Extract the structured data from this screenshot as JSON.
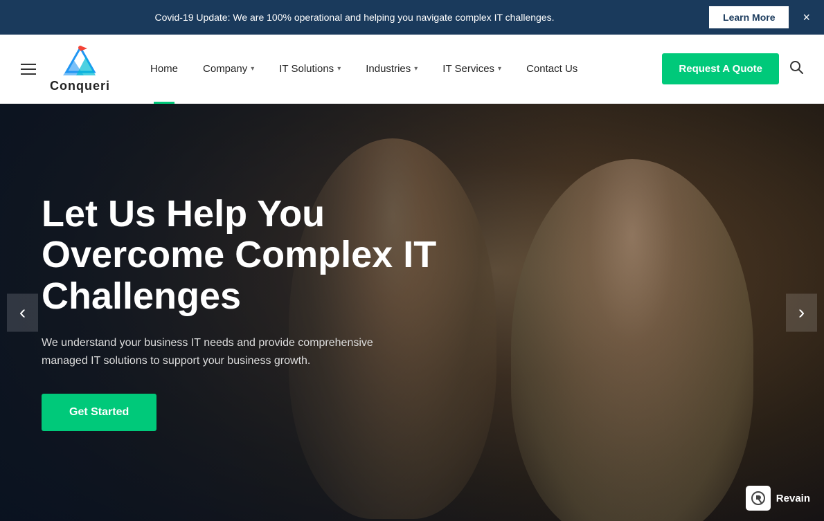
{
  "announcement": {
    "text": "Covid-19 Update: We are 100% operational and helping you navigate complex IT challenges.",
    "learn_more_label": "Learn More",
    "close_label": "×"
  },
  "navbar": {
    "logo_text": "Conqueri",
    "hamburger_label": "menu",
    "nav_items": [
      {
        "label": "Home",
        "has_dropdown": false,
        "active": true
      },
      {
        "label": "Company",
        "has_dropdown": true
      },
      {
        "label": "IT Solutions",
        "has_dropdown": true
      },
      {
        "label": "Industries",
        "has_dropdown": true
      },
      {
        "label": "IT Services",
        "has_dropdown": true
      },
      {
        "label": "Contact Us",
        "has_dropdown": false
      }
    ],
    "request_quote_label": "Request A Quote",
    "search_label": "search"
  },
  "hero": {
    "title": "Let Us Help You Overcome Complex IT Challenges",
    "subtitle": "We understand your business IT needs and provide comprehensive managed IT solutions to support your business growth.",
    "cta_label": "Get Started",
    "prev_label": "‹",
    "next_label": "›"
  },
  "revain": {
    "label": "Revain"
  }
}
